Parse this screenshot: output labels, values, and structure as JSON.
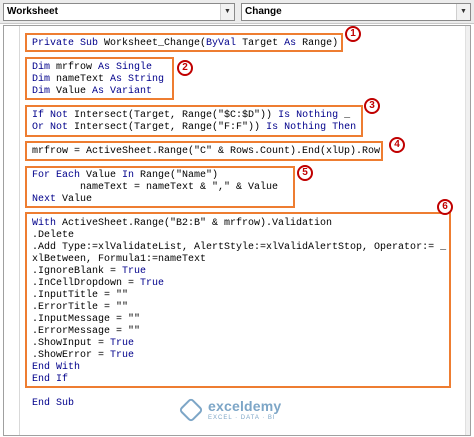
{
  "toolbar": {
    "object_dropdown": "Worksheet",
    "procedure_dropdown": "Change",
    "dropdown_arrow": "▼"
  },
  "code": {
    "lines": [
      [
        {
          "t": "Private Sub",
          "k": true
        },
        {
          "t": " Worksheet_Change("
        },
        {
          "t": "ByVal",
          "k": true
        },
        {
          "t": " Target "
        },
        {
          "t": "As",
          "k": true
        },
        {
          "t": " Range)"
        }
      ],
      [],
      [
        {
          "t": "Dim",
          "k": true
        },
        {
          "t": " mrfrow "
        },
        {
          "t": "As Single",
          "k": true
        }
      ],
      [
        {
          "t": "Dim",
          "k": true
        },
        {
          "t": " nameText "
        },
        {
          "t": "As String",
          "k": true
        }
      ],
      [
        {
          "t": "Dim",
          "k": true
        },
        {
          "t": " Value "
        },
        {
          "t": "As Variant",
          "k": true
        }
      ],
      [],
      [
        {
          "t": "If Not",
          "k": true
        },
        {
          "t": " Intersect(Target, Range(\"$C:$D\")) "
        },
        {
          "t": "Is Nothing",
          "k": true
        },
        {
          "t": " _"
        }
      ],
      [
        {
          "t": "Or Not",
          "k": true
        },
        {
          "t": " Intersect(Target, Range(\"F:F\")) "
        },
        {
          "t": "Is Nothing Then",
          "k": true
        }
      ],
      [],
      [
        {
          "t": "mrfrow = ActiveSheet.Range(\"C\" & Rows.Count).End(xlUp).Row"
        }
      ],
      [],
      [
        {
          "t": "For Each",
          "k": true
        },
        {
          "t": " Value "
        },
        {
          "t": "In",
          "k": true
        },
        {
          "t": " Range(\"Name\")"
        }
      ],
      [
        {
          "t": "        nameText = nameText & \",\" & Value"
        }
      ],
      [
        {
          "t": "Next",
          "k": true
        },
        {
          "t": " Value"
        }
      ],
      [],
      [
        {
          "t": "With",
          "k": true
        },
        {
          "t": " ActiveSheet.Range(\"B2:B\" & mrfrow).Validation"
        }
      ],
      [
        {
          "t": ".Delete"
        }
      ],
      [
        {
          "t": ".Add Type:=xlValidateList, AlertStyle:=xlValidAlertStop, Operator:= _"
        }
      ],
      [
        {
          "t": "xlBetween, Formula1:=nameText"
        }
      ],
      [
        {
          "t": ".IgnoreBlank = "
        },
        {
          "t": "True",
          "k": true
        }
      ],
      [
        {
          "t": ".InCellDropdown = "
        },
        {
          "t": "True",
          "k": true
        }
      ],
      [
        {
          "t": ".InputTitle = \"\""
        }
      ],
      [
        {
          "t": ".ErrorTitle = \"\""
        }
      ],
      [
        {
          "t": ".InputMessage = \"\""
        }
      ],
      [
        {
          "t": ".ErrorMessage = \"\""
        }
      ],
      [
        {
          "t": ".ShowInput = "
        },
        {
          "t": "True",
          "k": true
        }
      ],
      [
        {
          "t": ".ShowError = "
        },
        {
          "t": "True",
          "k": true
        }
      ],
      [
        {
          "t": "End With",
          "k": true
        }
      ],
      [
        {
          "t": "End If",
          "k": true
        }
      ],
      [],
      [
        {
          "t": "End Sub",
          "k": true
        }
      ]
    ]
  },
  "annotations": [
    "1",
    "2",
    "3",
    "4",
    "5",
    "6"
  ],
  "watermark": {
    "name": "exceldemy",
    "tagline": "EXCEL · DATA · BI"
  },
  "colors": {
    "keyword": "#00008b",
    "highlight_box": "#ee7d31",
    "badge": "#c00000"
  }
}
